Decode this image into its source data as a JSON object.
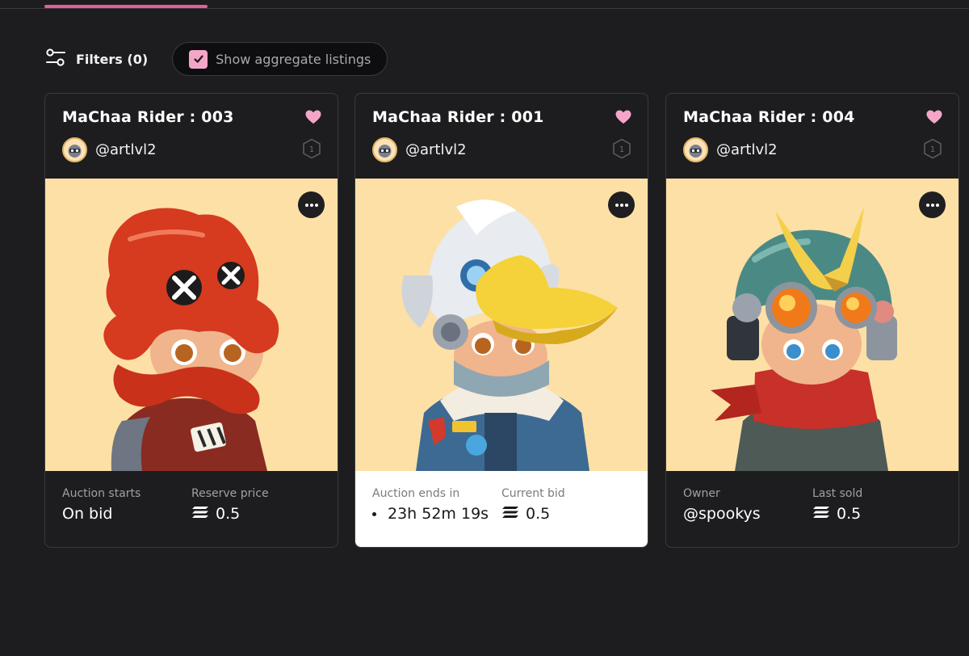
{
  "toolbar": {
    "filters_label": "Filters (0)",
    "aggregate_label": "Show aggregate listings",
    "aggregate_checked": true
  },
  "colors": {
    "accent_pink": "#e45d9c",
    "heart_pink": "#f4a6c9",
    "art_background": "#fde0a6",
    "page_background": "#1d1d1f"
  },
  "cards": [
    {
      "title": "MaChaa Rider : 003",
      "creator": "@artlvl2",
      "edition": "1",
      "stat1_label": "Auction starts",
      "stat1_value": "On bid",
      "stat2_label": "Reserve price",
      "stat2_value": "0.5",
      "icon": "red-octopus-helmet-rider"
    },
    {
      "title": "MaChaa Rider : 001",
      "creator": "@artlvl2",
      "edition": "1",
      "stat1_label": "Auction ends in",
      "stat1_value": "23h 52m 19s",
      "stat2_label": "Current bid",
      "stat2_value": "0.5",
      "icon": "duck-helmet-rider"
    },
    {
      "title": "MaChaa Rider : 004",
      "creator": "@artlvl2",
      "edition": "1",
      "stat1_label": "Owner",
      "stat1_value": "@spookys",
      "stat2_label": "Last sold",
      "stat2_value": "0.5",
      "icon": "horned-goggle-helmet-rider"
    }
  ]
}
